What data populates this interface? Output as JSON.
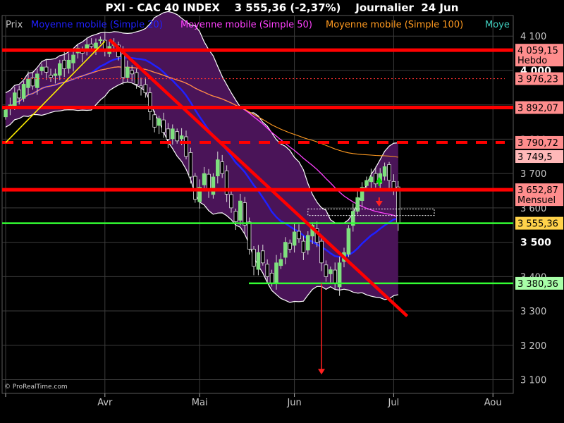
{
  "title": "PXI - CAC 40 INDEX    3 555,36 (-2,37%)    Journalier  24 Jun",
  "credit": "© ProRealTime.com",
  "legend": [
    {
      "label": "Prix",
      "color": "#c0c0c0"
    },
    {
      "label": "Moyenne mobile (Simple 20)",
      "color": "#2020ff"
    },
    {
      "label": "Moyenne mobile (Simple 50)",
      "color": "#ff40ff"
    },
    {
      "label": "Moyenne mobile (Simple 100)",
      "color": "#ff9a20"
    },
    {
      "label": "Moye",
      "color": "#40d0c0"
    }
  ],
  "chart_data": {
    "type": "candlestick",
    "title": "PXI - CAC 40 INDEX    3 555,36 (-2,37%)    Journalier  24 Jun",
    "ylim": [
      3060,
      4160
    ],
    "y_ticks": [
      {
        "value": 4100,
        "label": "4 100",
        "bold": false
      },
      {
        "value": 4000,
        "label": "4 000",
        "bold": true
      },
      {
        "value": 3900,
        "label": "3 900",
        "bold": false
      },
      {
        "value": 3800,
        "label": "3 800",
        "bold": false
      },
      {
        "value": 3700,
        "label": "3 700",
        "bold": false
      },
      {
        "value": 3600,
        "label": "3 600",
        "bold": false
      },
      {
        "value": 3500,
        "label": "3 500",
        "bold": true
      },
      {
        "value": 3400,
        "label": "3 400",
        "bold": false
      },
      {
        "value": 3300,
        "label": "3 300",
        "bold": false
      },
      {
        "value": 3200,
        "label": "3 200",
        "bold": false
      },
      {
        "value": 3100,
        "label": "3 100",
        "bold": false
      }
    ],
    "x_ticks": [
      {
        "index": 0,
        "label": ""
      },
      {
        "index": 22,
        "label": "Avr"
      },
      {
        "index": 43,
        "label": "Mai"
      },
      {
        "index": 64,
        "label": "Jun"
      },
      {
        "index": 86,
        "label": "Jul"
      },
      {
        "index": 108,
        "label": "Aou"
      }
    ],
    "closes": [
      3885,
      3900,
      3935,
      3920,
      3960,
      3975,
      3955,
      3990,
      4010,
      3995,
      3980,
      3990,
      4020,
      4005,
      4030,
      4045,
      4065,
      4050,
      4075,
      4070,
      4080,
      4090,
      4060,
      4070,
      4080,
      4040,
      3980,
      4010,
      3990,
      3960,
      3950,
      3935,
      3880,
      3835,
      3860,
      3820,
      3800,
      3830,
      3795,
      3810,
      3750,
      3690,
      3625,
      3660,
      3700,
      3650,
      3690,
      3740,
      3700,
      3640,
      3600,
      3560,
      3620,
      3550,
      3480,
      3430,
      3470,
      3440,
      3400,
      3380,
      3440,
      3450,
      3500,
      3480,
      3530,
      3510,
      3470,
      3520,
      3550,
      3500,
      3440,
      3400,
      3420,
      3380,
      3440,
      3470,
      3540,
      3590,
      3630,
      3660,
      3680,
      3690,
      3670,
      3700,
      3720,
      3680,
      3650,
      3556
    ],
    "series": [
      {
        "name": "Moyenne mobile (Simple 20)",
        "color": "#2020ff",
        "window": 20,
        "width": 2.5,
        "dash": ""
      },
      {
        "name": "Moyenne mobile (Simple 50)",
        "color": "#ff40ff",
        "window": 50,
        "width": 1.3,
        "dash": ""
      },
      {
        "name": "Moyenne mobile (Simple 100)",
        "color": "#ff9a20",
        "window": 100,
        "width": 1.1,
        "dash": ""
      }
    ],
    "bollinger": {
      "window": 20,
      "k": 2,
      "fill": "#4a1458",
      "edge": "#ffffff"
    },
    "annotations": {
      "horizontal_lines": [
        {
          "value": 4059.15,
          "color": "#ff0000",
          "width": 5,
          "dash": "",
          "x_from": 0,
          "x_to": "end"
        },
        {
          "value": 3976.23,
          "color": "#ff3030",
          "width": 1.2,
          "dash": "2,3",
          "x_from": 30,
          "x_to": "end"
        },
        {
          "value": 3892.07,
          "color": "#ff0000",
          "width": 5,
          "dash": "",
          "x_from": 0,
          "x_to": "end"
        },
        {
          "value": 3790.72,
          "color": "#ff0000",
          "width": 4,
          "dash": "16,12",
          "x_from": 0,
          "x_to": "end"
        },
        {
          "value": 3652.87,
          "color": "#ff0000",
          "width": 5,
          "dash": "",
          "x_from": 0,
          "x_to": "end"
        },
        {
          "value": 3555.36,
          "color": "#33ff33",
          "width": 2.5,
          "dash": "",
          "x_from": 0,
          "x_to": "end"
        },
        {
          "value": 3380.36,
          "color": "#33ff33",
          "width": 2.5,
          "dash": "",
          "x_from": 353,
          "x_to": "end"
        }
      ],
      "trend_lines": [
        {
          "x1i": 0,
          "y1": 3790,
          "x2i": 22,
          "y2": 4085,
          "color": "#ffee00",
          "width": 1.6
        },
        {
          "x1i": 23,
          "y1": 4090,
          "x2i": 89,
          "y2": 3285,
          "color": "#ff0000",
          "width": 4.5
        }
      ],
      "target_arrow": {
        "xi": 70,
        "y_from": 3380,
        "y_to": 3115,
        "color": "#ff2020"
      },
      "signal_up": {
        "xi": 82,
        "y": 3682,
        "color": "#00dd00"
      },
      "signal_down": {
        "xi": 82,
        "y": 3612,
        "color": "#ff2020"
      },
      "dotted_box": {
        "xi1": 67,
        "xi2": 95,
        "y1": 3597,
        "y2": 3578,
        "color": "#ffffff"
      }
    },
    "price_tags": [
      {
        "value": 4059.15,
        "label": "4 059,15",
        "sublabel": "Hebdo",
        "bg": "#ff8d8d"
      },
      {
        "value": 3976.23,
        "label": "3 976,23",
        "sublabel": "",
        "bg": "#ff8d8d"
      },
      {
        "value": 3892.07,
        "label": "3 892,07",
        "sublabel": "",
        "bg": "#ff8d8d"
      },
      {
        "value": 3790.72,
        "label": "3 790,72",
        "sublabel": "",
        "bg": "#ff8d8d"
      },
      {
        "value": 3749.5,
        "label": "3 749,5",
        "sublabel": "",
        "bg": "#ffb8b8"
      },
      {
        "value": 3652.87,
        "label": "3 652,87",
        "sublabel": "Mensuel",
        "bg": "#ff8d8d"
      },
      {
        "value": 3555.36,
        "label": "3 555,36",
        "sublabel": "",
        "bg": "#ffd24a"
      },
      {
        "value": 3380.36,
        "label": "3 380,36",
        "sublabel": "",
        "bg": "#a8ffa8"
      }
    ]
  }
}
